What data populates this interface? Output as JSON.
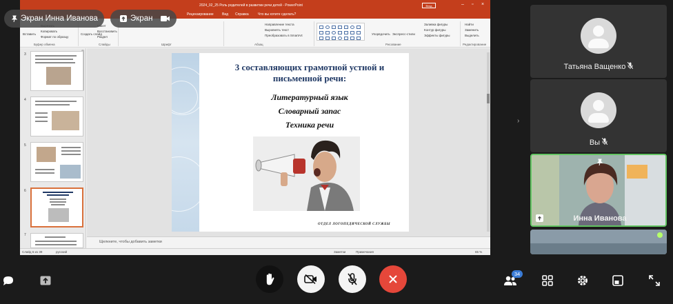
{
  "pills": {
    "screen_owner": "Экран Инна Иванова",
    "screen": "Экран"
  },
  "powerpoint": {
    "title": "2024_02_25 Роль родителей в развитии речи детей - PowerPoint",
    "signin": "Вход",
    "tabs": [
      "Рецензирование",
      "Вид",
      "Справка",
      "Что вы хотите сделать?"
    ],
    "ribbon": {
      "clipboard": [
        "Вставить",
        "Вырезать",
        "Копировать",
        "Формат по образцу"
      ],
      "slides": [
        "Создать слайд",
        "Макет",
        "Восстановить",
        "Раздел"
      ],
      "groups": [
        "Буфер обмена",
        "Слайды",
        "Шрифт",
        "Абзац",
        "Рисование",
        "Редактирование"
      ],
      "paragraph": [
        "Направление текста",
        "Выровнять текст",
        "Преобразовать в SmartArt"
      ],
      "drawing": [
        "Упорядочить",
        "Экспресс-стили",
        "Заливка фигуры",
        "Контур фигуры",
        "Эффекты фигуры"
      ],
      "editing": [
        "Найти",
        "Заменить",
        "Выделить"
      ]
    },
    "thumbnails": [
      {
        "num": "3",
        "selected": false
      },
      {
        "num": "4",
        "selected": false
      },
      {
        "num": "5",
        "selected": false
      },
      {
        "num": "6",
        "selected": true
      },
      {
        "num": "7",
        "selected": false
      }
    ],
    "slide": {
      "title_line1": "3 составляющих грамотной устной и",
      "title_line2": "письменной речи:",
      "items": [
        "Литературный язык",
        "Словарный запас",
        "Техника речи"
      ],
      "footer": "ОТДЕЛ ЛОГОПЕДИЧЕСКОЙ СЛУЖБЫ"
    },
    "notes_placeholder": "Щелкните, чтобы добавить заметки",
    "status": {
      "slide_counter": "Слайд 6 из 39",
      "language": "русский",
      "notes": "Заметки",
      "comments": "Примечания",
      "zoom": "65 %"
    }
  },
  "participants": [
    {
      "name": "Татьяна Ващенко",
      "muted": true,
      "video": false
    },
    {
      "name": "Вы",
      "muted": true,
      "video": false
    },
    {
      "name": "Инна Иванова",
      "muted": false,
      "video": true
    }
  ],
  "toolbar": {
    "participants_count": "34"
  },
  "colors": {
    "accent": "#3a7bd5",
    "end_call": "#e5473a",
    "active_speaker": "#62c462",
    "powerpoint_brand": "#c43e1c"
  }
}
